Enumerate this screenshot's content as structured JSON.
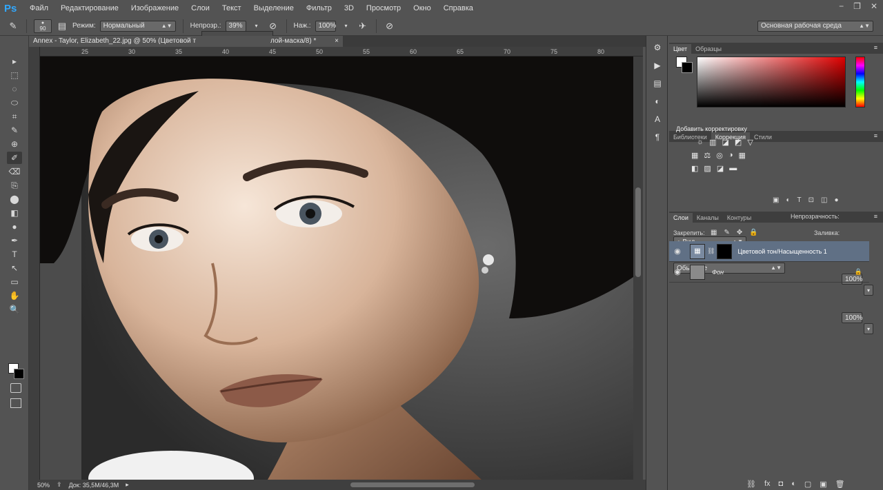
{
  "app": {
    "logo": "Ps"
  },
  "menu": [
    "Файл",
    "Редактирование",
    "Изображение",
    "Слои",
    "Текст",
    "Выделение",
    "Фильтр",
    "3D",
    "Просмотр",
    "Окно",
    "Справка"
  ],
  "window_controls": [
    "−",
    "❐",
    "✕"
  ],
  "options": {
    "brush_size": "90",
    "mode_label": "Режим:",
    "mode_value": "Нормальный",
    "opacity_label": "Непрозр.:",
    "opacity_value": "39%",
    "flow_label": "Наж.:",
    "flow_value": "100%",
    "workspace": "Основная рабочая среда"
  },
  "document": {
    "tab_title": "Annex - Taylor, Elizabeth_22.jpg @ 50% (Цветовой т",
    "tab_title_tail": "лой-маска/8) *",
    "zoom": "50%",
    "doc_size": "Док: 35,5M/46,3M",
    "ruler_ticks": [
      "25",
      "30",
      "35",
      "40",
      "45",
      "50",
      "55",
      "60",
      "65",
      "70",
      "75",
      "80"
    ]
  },
  "color_panel": {
    "tabs": [
      "Цвет",
      "Образцы"
    ],
    "active": 0
  },
  "adjust_panel": {
    "tabs": [
      "Библиотеки",
      "Коррекция",
      "Стили"
    ],
    "active": 1,
    "title": "Добавить корректировку",
    "row1": [
      "☼",
      "▥",
      "◪",
      "◩",
      "▽"
    ],
    "row2": [
      "▦",
      "⚖",
      "◎",
      "◑",
      "▦"
    ],
    "row3": [
      "◧",
      "▨",
      "◪",
      "▬"
    ]
  },
  "layers_panel": {
    "tabs": [
      "Слои",
      "Каналы",
      "Контуры"
    ],
    "active": 0,
    "filter_label": "Вид",
    "blend_mode": "Обычные",
    "opacity_label": "Непрозрачность:",
    "opacity_value": "100%",
    "lock_label": "Закрепить:",
    "fill_label": "Заливка:",
    "fill_value": "100%",
    "layers": [
      {
        "name": "Цветовой тон/Насыщенность 1",
        "selected": true
      },
      {
        "name": "Фон",
        "selected": false
      }
    ],
    "bottom_icons": [
      "⛓",
      "fx",
      "◘",
      "◐",
      "▢",
      "▣",
      "🗑"
    ]
  },
  "tools": [
    "▸",
    "⬚",
    "◌",
    "⬭",
    "⌗",
    "✎",
    "⊕",
    "✐",
    "⌫",
    "⎘",
    "⬤",
    "◧",
    "●",
    "✒",
    "T",
    "↖",
    "▭",
    "✋",
    "🔍"
  ],
  "colors": {
    "fg": "#ffffff",
    "bg": "#000000",
    "accent": "#607085"
  }
}
